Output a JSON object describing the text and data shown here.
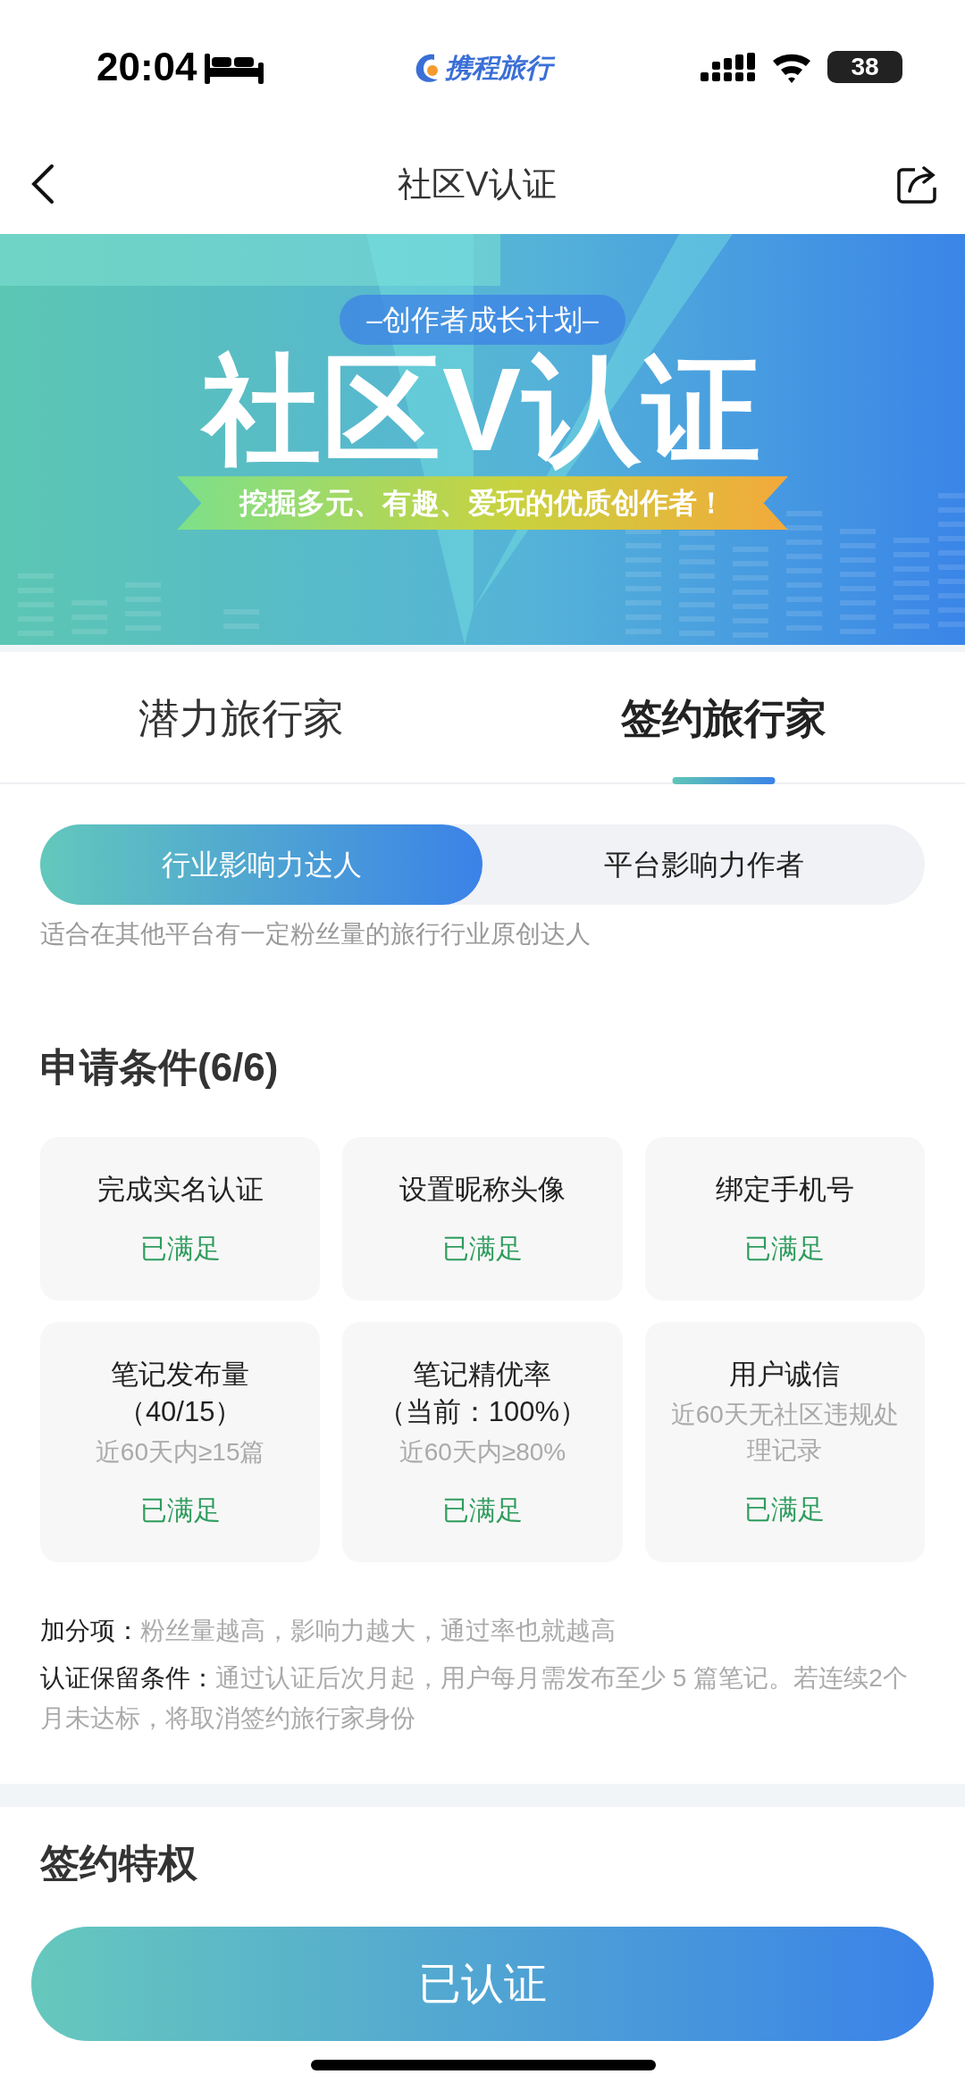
{
  "status_bar": {
    "time": "20:04",
    "app_logo": "携程旅行",
    "battery": "38"
  },
  "nav": {
    "title": "社区V认证"
  },
  "banner": {
    "kicker": "–创作者成长计划–",
    "title": "社区V认证",
    "slogan": "挖掘多元、有趣、爱玩的优质创作者！"
  },
  "tabs": [
    {
      "label": "潜力旅行家",
      "selected": false
    },
    {
      "label": "签约旅行家",
      "selected": true
    }
  ],
  "segments": [
    {
      "label": "行业影响力达人",
      "selected": true
    },
    {
      "label": "平台影响力作者",
      "selected": false
    }
  ],
  "segment_description": "适合在其他平台有一定粉丝量的旅行行业原创达人",
  "conditions": {
    "title": "申请条件(6/6)",
    "items": [
      {
        "title": "完成实名认证",
        "status": "已满足",
        "met": true
      },
      {
        "title": "设置昵称头像",
        "status": "已满足",
        "met": true
      },
      {
        "title": "绑定手机号",
        "status": "已满足",
        "met": true
      },
      {
        "title": "笔记发布量",
        "value": "（40/15）",
        "requirement": "近60天内≥15篇",
        "status": "已满足",
        "met": true
      },
      {
        "title": "笔记精优率",
        "value": "（当前：100%）",
        "requirement": "近60天内≥80%",
        "status": "已满足",
        "met": true
      },
      {
        "title": "用户诚信",
        "requirement": "近60天无社区违规处理记录",
        "status": "已满足",
        "met": true
      }
    ]
  },
  "notes": [
    {
      "label": "加分项：",
      "text": "粉丝量越高，影响力越大，通过率也就越高"
    },
    {
      "label": "认证保留条件：",
      "text": "通过认证后次月起，用户每月需发布至少 5 篇笔记。若连续2个月未达标，将取消签约旅行家身份"
    }
  ],
  "next_section": {
    "title": "签约特权"
  },
  "action_button": {
    "label": "已认证"
  }
}
